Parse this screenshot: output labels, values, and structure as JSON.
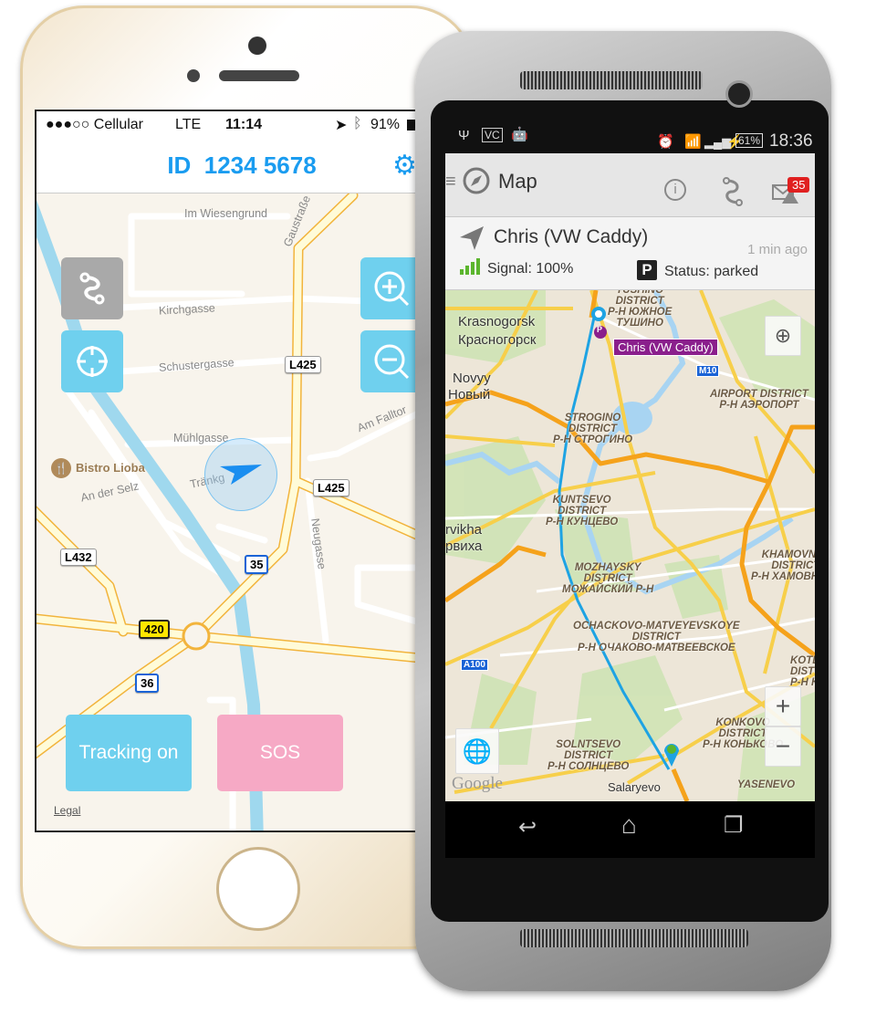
{
  "ios": {
    "status": {
      "carrier": "●●●○○ Cellular",
      "network": "LTE",
      "time": "11:14",
      "battery": "91%"
    },
    "header": {
      "id_label": "ID",
      "id_value": "1234 5678"
    },
    "map": {
      "streets": {
        "im_wiesengrund": "Im Wiesengrund",
        "gaustrasse": "Gaustraße",
        "kirchgasse": "Kirchgasse",
        "schustergasse": "Schustergasse",
        "muehlgasse": "Mühlgasse",
        "am_falltor": "Am Falltor",
        "an_der_selz": "An der Selz",
        "traenkgasse": "Tränkg",
        "neugasse": "Neugasse"
      },
      "poi": "Bistro Lioba",
      "shields": {
        "l425a": "L425",
        "l425b": "L425",
        "l432": "L432",
        "r35": "35",
        "r420": "420",
        "r36": "36"
      },
      "legal": "Legal"
    },
    "buttons": {
      "tracking": "Tracking on",
      "sos": "SOS"
    },
    "colors": {
      "accent": "#1a9cf0",
      "button_blue": "#6fd0ee",
      "button_pink": "#f6a9c5",
      "route_button": "#a9a9a9"
    }
  },
  "android": {
    "status": {
      "battery": "61%",
      "time": "18:36"
    },
    "action_bar": {
      "title": "Map",
      "alert_badge": "35"
    },
    "card": {
      "name": "Chris (VW Caddy)",
      "age": "1 min ago",
      "signal": "Signal: 100%",
      "status": "Status: parked",
      "parking_letter": "P"
    },
    "map": {
      "cities": {
        "krasnogorsk": "Krasnogorsk",
        "krasnogorsk_ru": "Красногорск",
        "novyy": "Novyy",
        "novyy_ru": "Новый",
        "barvikha": "rvikha",
        "barvikha_ru": "рвиха",
        "salaryevo": "Salaryevo"
      },
      "districts": {
        "tushino": "TUSHINO\nDISTRICT\nР-Н ЮЖНОЕ\nТУШИНО",
        "airport": "AIRPORT DISTRICT\nР-Н АЭРОПОРТ",
        "strogino": "STROGINO\nDISTRICT\nР-Н СТРОГИНО",
        "kuntsevo": "KUNTSEVO\nDISTRICT\nР-Н КУНЦЕВО",
        "mozhaysky": "MOZHAYSKY\nDISTRICT\nМОЖАЙСКИЙ Р-Н",
        "khamovniki": "KHAMOVNIKI\nDISTRICT\nР-Н ХАМОВНИКИ",
        "ochakovo": "OCHACKOVO-MATVEYEVSKOYE\nDISTRICT\nР-Н ОЧАКОВО-МАТВЕЕВСКОЕ",
        "kotlovka": "KOTL\nDIST\nР-Н КОТ",
        "solntsevo": "SOLNTSEVO\nDISTRICT\nР-Н СОЛНЦЕВО",
        "konkovo": "KONKOVO\nDISTRICT\nР-Н КОНЬКОВО",
        "yasenevo": "YASENEVO"
      },
      "shields": {
        "m10": "M10",
        "a100": "A100"
      },
      "vehicle_label": "Chris (VW Caddy)",
      "parking_letter": "P",
      "google": "Google",
      "zoom_in": "+",
      "zoom_out": "−"
    },
    "colors": {
      "route": "#1ea3e3",
      "label": "#8a1f8c",
      "badge": "#e02020",
      "signal": "#5bb52d",
      "highway": "#f5a21b"
    }
  }
}
